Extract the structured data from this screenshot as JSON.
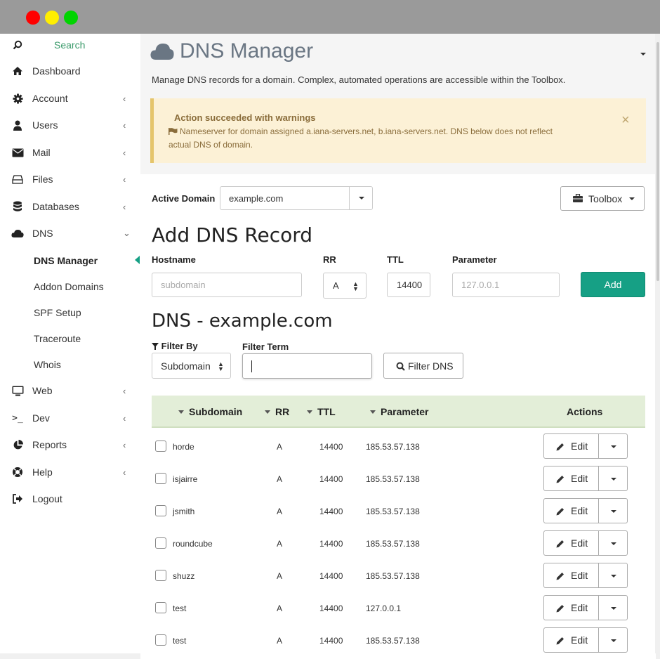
{
  "sidebar": {
    "search_label": "Search",
    "items": [
      {
        "label": "Dashboard",
        "icon": "home-icon"
      },
      {
        "label": "Account",
        "icon": "gear-icon",
        "chevron": "‹"
      },
      {
        "label": "Users",
        "icon": "user-icon",
        "chevron": "‹"
      },
      {
        "label": "Mail",
        "icon": "envelope-icon",
        "chevron": "‹"
      },
      {
        "label": "Files",
        "icon": "hdd-icon",
        "chevron": "‹"
      },
      {
        "label": "Databases",
        "icon": "database-icon",
        "chevron": "‹"
      },
      {
        "label": "DNS",
        "icon": "cloud-icon",
        "chevron": "⌄"
      }
    ],
    "dns_subitems": [
      "DNS Manager",
      "Addon Domains",
      "SPF Setup",
      "Traceroute",
      "Whois"
    ],
    "items_after": [
      {
        "label": "Web",
        "icon": "monitor-icon",
        "chevron": "‹"
      },
      {
        "label": "Dev",
        "icon": "terminal-icon",
        "chevron": "‹"
      },
      {
        "label": "Reports",
        "icon": "pie-chart-icon",
        "chevron": "‹"
      },
      {
        "label": "Help",
        "icon": "lifebuoy-icon",
        "chevron": "‹"
      },
      {
        "label": "Logout",
        "icon": "sign-out-icon"
      }
    ]
  },
  "header": {
    "title": "DNS Manager",
    "subtitle": "Manage DNS records for a domain. Complex, automated operations are accessible within the Toolbox."
  },
  "alert": {
    "heading": "Action succeeded with warnings",
    "message": "Nameserver for domain assigned a.iana-servers.net, b.iana-servers.net. DNS below does not reflect actual DNS of domain.",
    "close": "×"
  },
  "domain_bar": {
    "label": "Active Domain",
    "value": "example.com",
    "toolbox_label": "Toolbox"
  },
  "add_record": {
    "heading": "Add DNS Record",
    "hostname_label": "Hostname",
    "hostname_placeholder": "subdomain",
    "rr_label": "RR",
    "rr_value": "A",
    "ttl_label": "TTL",
    "ttl_value": "14400",
    "parameter_label": "Parameter",
    "parameter_placeholder": "127.0.0.1",
    "add_button": "Add"
  },
  "dns_list": {
    "heading": "DNS - example.com",
    "filter_by_label": "Filter By",
    "filter_by_value": "Subdomain",
    "filter_term_label": "Filter Term",
    "filter_term_value": "",
    "filter_button": "Filter DNS",
    "columns": [
      "Subdomain",
      "RR",
      "TTL",
      "Parameter",
      "Actions"
    ],
    "edit_label": "Edit",
    "rows": [
      {
        "subdomain": "horde",
        "rr": "A",
        "ttl": "14400",
        "parameter": "185.53.57.138"
      },
      {
        "subdomain": "isjairre",
        "rr": "A",
        "ttl": "14400",
        "parameter": "185.53.57.138"
      },
      {
        "subdomain": "jsmith",
        "rr": "A",
        "ttl": "14400",
        "parameter": "185.53.57.138"
      },
      {
        "subdomain": "roundcube",
        "rr": "A",
        "ttl": "14400",
        "parameter": "185.53.57.138"
      },
      {
        "subdomain": "shuzz",
        "rr": "A",
        "ttl": "14400",
        "parameter": "185.53.57.138"
      },
      {
        "subdomain": "test",
        "rr": "A",
        "ttl": "14400",
        "parameter": "127.0.0.1"
      },
      {
        "subdomain": "test",
        "rr": "A",
        "ttl": "14400",
        "parameter": "185.53.57.138"
      }
    ]
  },
  "colors": {
    "accent": "#16a085",
    "alert_bg": "#fcf1d6",
    "table_header_bg": "#e3eed8"
  }
}
